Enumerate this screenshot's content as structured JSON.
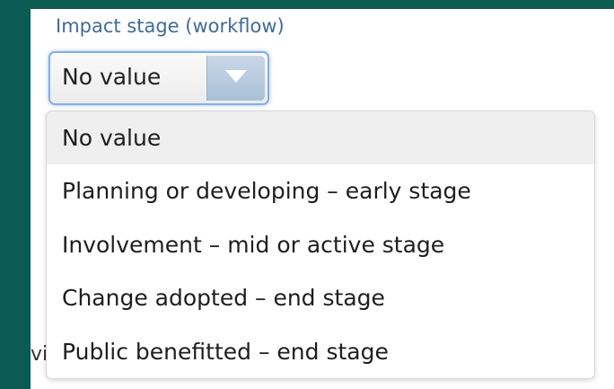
{
  "field": {
    "label": "Impact stage (workflow)",
    "selected_value": "No value",
    "arrow_icon": "chevron-down-icon"
  },
  "behind_text": "vi",
  "dropdown": {
    "options": [
      {
        "label": "No value",
        "highlighted": true
      },
      {
        "label": "Planning or developing – early stage",
        "highlighted": false
      },
      {
        "label": "Involvement – mid or active stage",
        "highlighted": false
      },
      {
        "label": "Change adopted – end stage",
        "highlighted": false
      },
      {
        "label": "Public benefitted – end stage",
        "highlighted": false
      }
    ]
  },
  "colors": {
    "background": "#0b5a54",
    "label": "#3f6b9a",
    "focus_ring": "#7fb0e8",
    "highlight": "#efefef"
  }
}
